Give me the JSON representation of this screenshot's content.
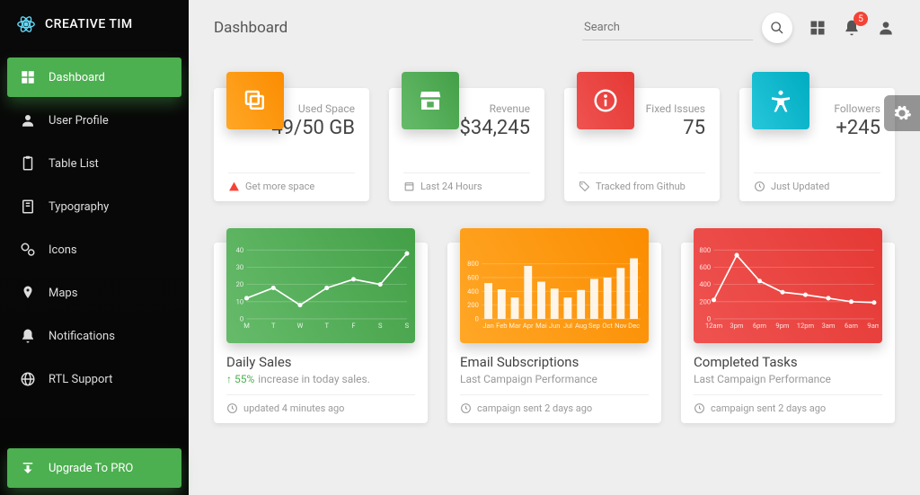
{
  "brand": "CREATIVE TIM",
  "page_title": "Dashboard",
  "search_placeholder": "Search",
  "notifications_count": "5",
  "nav": [
    {
      "label": "Dashboard",
      "icon": "dashboard",
      "active": true
    },
    {
      "label": "User Profile",
      "icon": "person"
    },
    {
      "label": "Table List",
      "icon": "clipboard"
    },
    {
      "label": "Typography",
      "icon": "book"
    },
    {
      "label": "Icons",
      "icon": "bubble"
    },
    {
      "label": "Maps",
      "icon": "pin"
    },
    {
      "label": "Notifications",
      "icon": "bell"
    },
    {
      "label": "RTL Support",
      "icon": "globe"
    }
  ],
  "upgrade_label": "Upgrade To PRO",
  "stats": [
    {
      "label": "Used Space",
      "value": "49/50 GB",
      "foot": "Get more space",
      "foot_icon": "warn",
      "color": "orange",
      "icon": "copy"
    },
    {
      "label": "Revenue",
      "value": "$34,245",
      "foot": "Last 24 Hours",
      "foot_icon": "calendar",
      "color": "green",
      "icon": "store"
    },
    {
      "label": "Fixed Issues",
      "value": "75",
      "foot": "Tracked from Github",
      "foot_icon": "tag",
      "color": "red",
      "icon": "info"
    },
    {
      "label": "Followers",
      "value": "+245",
      "foot": "Just Updated",
      "foot_icon": "clock",
      "color": "cyan",
      "icon": "accessibility"
    }
  ],
  "charts": [
    {
      "title": "Daily Sales",
      "sub_prefix": "↑ 55%",
      "sub": "increase in today sales.",
      "foot": "updated 4 minutes ago",
      "color": "green"
    },
    {
      "title": "Email Subscriptions",
      "sub": "Last Campaign Performance",
      "foot": "campaign sent 2 days ago",
      "color": "orange"
    },
    {
      "title": "Completed Tasks",
      "sub": "Last Campaign Performance",
      "foot": "campaign sent 2 days ago",
      "color": "red"
    }
  ],
  "chart_data": [
    {
      "type": "line",
      "categories": [
        "M",
        "T",
        "W",
        "T",
        "F",
        "S",
        "S"
      ],
      "values": [
        12,
        18,
        8,
        18,
        23,
        20,
        38
      ],
      "ylim": [
        0,
        40
      ],
      "yticks": [
        0,
        10,
        20,
        30,
        40
      ]
    },
    {
      "type": "bar",
      "categories": [
        "Jan",
        "Feb",
        "Mar",
        "Apr",
        "Mai",
        "Jun",
        "Jul",
        "Aug",
        "Sep",
        "Oct",
        "Nov",
        "Dec"
      ],
      "values": [
        520,
        430,
        310,
        770,
        540,
        440,
        310,
        420,
        580,
        600,
        740,
        880
      ],
      "ylim": [
        0,
        1000
      ],
      "yticks": [
        0,
        200,
        400,
        600,
        800
      ]
    },
    {
      "type": "line",
      "categories": [
        "12am",
        "3pm",
        "6pm",
        "9pm",
        "12pm",
        "3am",
        "6am",
        "9am"
      ],
      "values": [
        220,
        740,
        440,
        310,
        280,
        240,
        200,
        190
      ],
      "ylim": [
        0,
        800
      ],
      "yticks": [
        0,
        200,
        400,
        600,
        800
      ]
    }
  ]
}
